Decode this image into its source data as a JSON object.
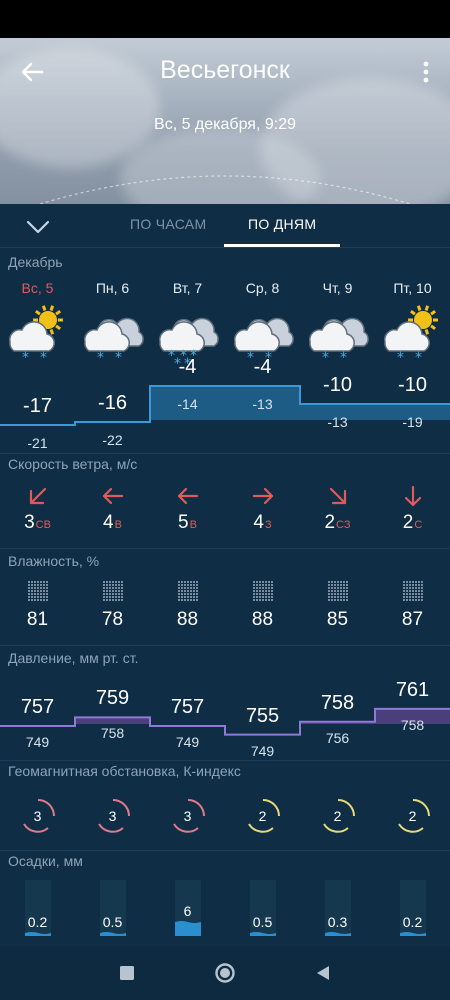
{
  "header": {
    "city": "Весьегонск",
    "datetime": "Вс, 5 декабря, 9:29",
    "back_icon": "arrow-left-icon",
    "menu_icon": "more-vert-icon"
  },
  "tabs": {
    "hours": "ПО ЧАСАМ",
    "days": "ПО ДНЯМ",
    "active": "days"
  },
  "month_label": "Декабрь",
  "days": [
    {
      "name": "Вс, 5",
      "weekend": true,
      "icon": "sun-cloud-snow-icon",
      "high": "-17",
      "low": "-21",
      "wind_speed": "3",
      "wind_dir": "СВ",
      "wind_icon": "arrow-down-left-icon",
      "humidity": "81",
      "pressure_high": "757",
      "pressure_low": "749",
      "kindex": "3",
      "precip": "0.2"
    },
    {
      "name": "Пн, 6",
      "weekend": false,
      "icon": "cloud-snow-icon",
      "high": "-16",
      "low": "-22",
      "wind_speed": "4",
      "wind_dir": "В",
      "wind_icon": "arrow-left-icon",
      "humidity": "78",
      "pressure_high": "759",
      "pressure_low": "758",
      "kindex": "3",
      "precip": "0.5"
    },
    {
      "name": "Вт, 7",
      "weekend": false,
      "icon": "cloud-heavy-snow-icon",
      "high": "-4",
      "low": "-14",
      "wind_speed": "5",
      "wind_dir": "В",
      "wind_icon": "arrow-left-icon",
      "humidity": "88",
      "pressure_high": "757",
      "pressure_low": "749",
      "kindex": "3",
      "precip": "6"
    },
    {
      "name": "Ср, 8",
      "weekend": false,
      "icon": "cloud-snow-icon",
      "high": "-4",
      "low": "-13",
      "wind_speed": "4",
      "wind_dir": "З",
      "wind_icon": "arrow-right-icon",
      "humidity": "88",
      "pressure_high": "755",
      "pressure_low": "749",
      "kindex": "2",
      "precip": "0.5"
    },
    {
      "name": "Чт, 9",
      "weekend": false,
      "icon": "cloud-snow-icon",
      "high": "-10",
      "low": "-13",
      "wind_speed": "2",
      "wind_dir": "СЗ",
      "wind_icon": "arrow-down-right-icon",
      "humidity": "85",
      "pressure_high": "758",
      "pressure_low": "756",
      "kindex": "2",
      "precip": "0.3"
    },
    {
      "name": "Пт, 10",
      "weekend": false,
      "icon": "sun-cloud-snow-icon",
      "high": "-10",
      "low": "-19",
      "wind_speed": "2",
      "wind_dir": "С",
      "wind_icon": "arrow-down-icon",
      "humidity": "87",
      "pressure_high": "761",
      "pressure_low": "758",
      "kindex": "2",
      "precip": "0.2"
    }
  ],
  "sections": {
    "wind": "Скорость ветра, м/с",
    "humidity": "Влажность, %",
    "pressure": "Давление, мм рт. ст.",
    "geomagnetic": "Геомагнитная обстановка, К-индекс",
    "precip": "Осадки, мм"
  },
  "colors": {
    "background": "#0f2d44",
    "temp_band": "#1d5d85",
    "temp_line": "#3a9ad9",
    "pressure_band": "#4a3f7a",
    "pressure_line": "#8f7ad6",
    "accent_red": "#e05a5a",
    "kindex_3": "#e07a8a",
    "kindex_2": "#e6d97a",
    "precip_bar": "#2a8fd0"
  },
  "navbar": [
    "square-nav-icon",
    "circle-nav-icon",
    "triangle-back-icon"
  ]
}
